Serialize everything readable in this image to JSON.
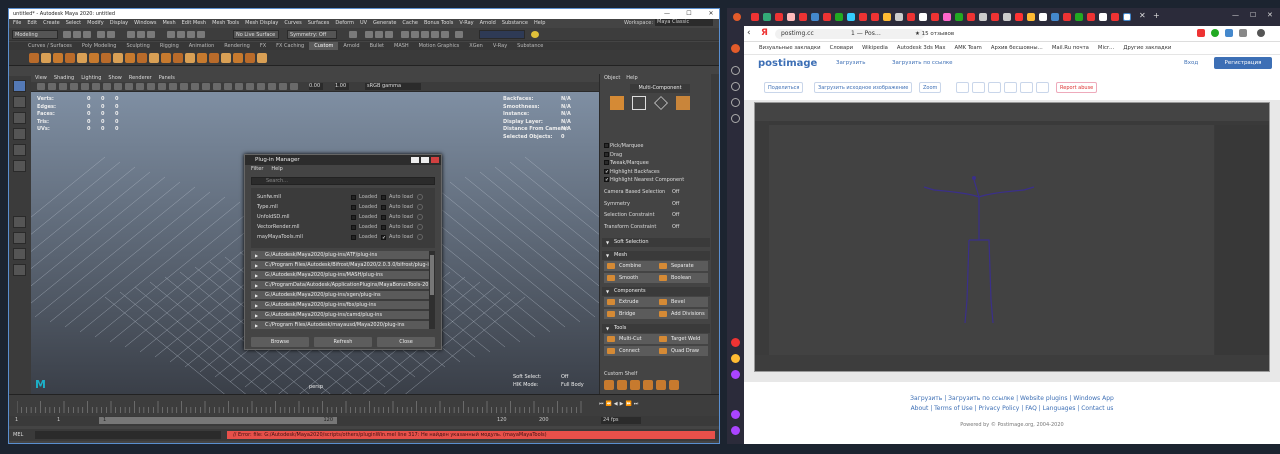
{
  "maya": {
    "title": "untitled* - Autodesk Maya 2020: untitled",
    "menus": [
      "File",
      "Edit",
      "Create",
      "Select",
      "Modify",
      "Display",
      "Windows",
      "Mesh",
      "Edit Mesh",
      "Mesh Tools",
      "Mesh Display",
      "Curves",
      "Surfaces",
      "Deform",
      "UV",
      "Generate",
      "Cache",
      "Bonus Tools",
      "V-Ray",
      "Arnold",
      "Substance",
      "Help"
    ],
    "workspace_label": "Workspace:",
    "workspace_value": "Maya Classic",
    "mode": "Modeling",
    "live_surface": "No Live Surface",
    "symmetry": "Symmetry: Off",
    "shelf_tabs": [
      "Curves / Surfaces",
      "Poly Modeling",
      "Sculpting",
      "Rigging",
      "Animation",
      "Rendering",
      "FX",
      "FX Caching",
      "Custom",
      "Arnold",
      "Bullet",
      "MASH",
      "Motion Graphics",
      "XGen",
      "V-Ray",
      "Substance"
    ],
    "active_shelf": "Custom",
    "panel_menus": [
      "View",
      "Shading",
      "Lighting",
      "Show",
      "Renderer",
      "Panels"
    ],
    "gamma": "sRGB gamma",
    "val1": "0.00",
    "val2": "1.00",
    "hud_left": [
      {
        "label": "Verts:",
        "v1": "0",
        "v2": "0",
        "v3": "0"
      },
      {
        "label": "Edges:",
        "v1": "0",
        "v2": "0",
        "v3": "0"
      },
      {
        "label": "Faces:",
        "v1": "0",
        "v2": "0",
        "v3": "0"
      },
      {
        "label": "Tris:",
        "v1": "0",
        "v2": "0",
        "v3": "0"
      },
      {
        "label": "UVs:",
        "v1": "0",
        "v2": "0",
        "v3": "0"
      }
    ],
    "hud_right": [
      {
        "label": "Backfaces:",
        "value": "N/A"
      },
      {
        "label": "Smoothness:",
        "value": "N/A"
      },
      {
        "label": "Instance:",
        "value": "N/A"
      },
      {
        "label": "Display Layer:",
        "value": "N/A"
      },
      {
        "label": "Distance From Camera:",
        "value": "N/A"
      },
      {
        "label": "Selected Objects:",
        "value": "0"
      }
    ],
    "camera": "persp",
    "soft_select_label": "Soft Select:",
    "soft_select_value": "Off",
    "hik_label": "HIK Mode:",
    "hik_value": "Full Body",
    "attr_menus": [
      "Object",
      "Help"
    ],
    "multi_component": "Multi-Component",
    "pick_options": [
      {
        "label": "Pick/Marquee",
        "checked": false
      },
      {
        "label": "Drag",
        "checked": false
      },
      {
        "label": "Tweak/Marquee",
        "checked": false
      },
      {
        "label": "Highlight Backfaces",
        "checked": true
      },
      {
        "label": "Highlight Nearest Component",
        "checked": true
      }
    ],
    "settings": [
      {
        "label": "Camera Based Selection",
        "value": "Off"
      },
      {
        "label": "Symmetry",
        "value": "Off"
      },
      {
        "label": "Selection Constraint",
        "value": "Off"
      },
      {
        "label": "Transform Constraint",
        "value": "Off"
      }
    ],
    "sections": {
      "soft": "Soft Selection",
      "mesh": "Mesh",
      "components": "Components",
      "tools": "Tools",
      "custom": "Custom Shelf"
    },
    "mesh_buttons": [
      "Combine",
      "Separate",
      "Smooth",
      "Boolean"
    ],
    "component_buttons": [
      "Extrude",
      "Bevel",
      "Bridge",
      "Add Divisions"
    ],
    "tool_buttons": [
      "Multi-Cut",
      "Target Weld",
      "Connect",
      "Quad Draw"
    ],
    "time_start": "1",
    "time_start2": "1",
    "time_cur": "1",
    "range_end": "120",
    "range_end2": "120",
    "range_end3": "200",
    "fps": "24 fps",
    "mel": "MEL",
    "error": "// Error: file: G:/Autodesk/Maya2020/scripts/others/pluginWin.mel line 317: Не найден указанный модуль.  (mayaMayaTools)"
  },
  "plugin": {
    "title": "Plug-in Manager",
    "menus": [
      "Filter",
      "Help"
    ],
    "search_placeholder": "Search...",
    "loaded_label": "Loaded",
    "autoload_label": "Auto load",
    "plugins": [
      {
        "name": "Sunfw.mll",
        "loaded": false,
        "auto": false
      },
      {
        "name": "Type.mll",
        "loaded": false,
        "auto": false
      },
      {
        "name": "UnfoldSD.mll",
        "loaded": false,
        "auto": false
      },
      {
        "name": "VectorRender.mll",
        "loaded": false,
        "auto": false
      },
      {
        "name": "mayMayaTools.mll",
        "loaded": false,
        "auto": true
      }
    ],
    "paths": [
      "G:/Autodesk/Maya2020/plug-ins/ATF/plug-ins",
      "C:/Program Files/Autodesk/Bifrost/Maya2020/2.0.3.0/bifrost/plug-ins",
      "G:/Autodesk/Maya2020/plug-ins/MASH/plug-ins",
      "C:/ProgramData/Autodesk/ApplicationPlugins/MayaBonusTools-2017-2020",
      "G:/Autodesk/Maya2020/plug-ins/xgen/plug-ins",
      "G:/Autodesk/Maya2020/plug-ins/fbx/plug-ins",
      "G:/Autodesk/Maya2020/plug-ins/camd/plug-ins",
      "C:/Program Files/Autodesk/mayausd/Maya2020/plug-ins"
    ],
    "buttons": [
      "Browse",
      "Refresh",
      "Close"
    ]
  },
  "browser": {
    "url": "postimg.cc",
    "page_title": "1 — Pos…",
    "reviews": "★ 15 отзывов",
    "bookmarks": [
      "Визуальные закладки",
      "Словари",
      "Wikipedia",
      "Autodesk 3ds Max",
      "AMK Team",
      "Архив бесшовны…",
      "Mail.Ru почта",
      "Micr…",
      "Другие закладки"
    ],
    "logo": "postimage",
    "upload": "Загрузить",
    "upload_url": "Загрузить по ссылке",
    "login": "Вход",
    "register": "Регистрация",
    "share": [
      "Поделиться",
      "Загрузить исходное изображение",
      "Zoom",
      "Report abuse"
    ],
    "footer_line1": "Загрузить   |   Загрузить по ссылке   |   Website plugins   |   Windows App",
    "footer_line2": "About  |  Terms of Use  |  Privacy Policy  |  FAQ  |  Languages  |  Contact us",
    "footer_line3": "Powered by © Postimage.org, 2004-2020"
  }
}
